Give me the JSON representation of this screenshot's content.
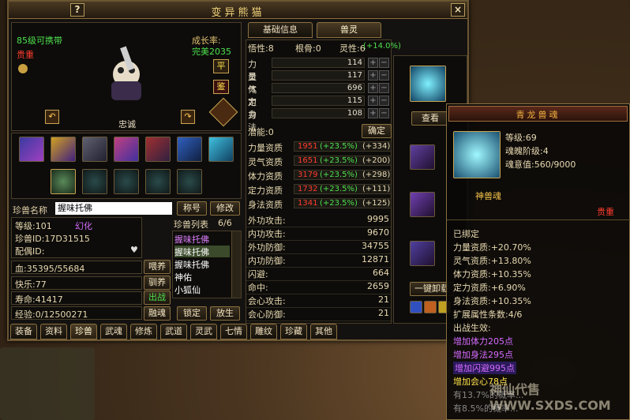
{
  "window": {
    "title": "变异熊猫",
    "help_label": "?",
    "close_label": "×"
  },
  "tabs": {
    "basic": "基础信息",
    "spirit": "兽灵"
  },
  "pet": {
    "level_text": "85级可携带",
    "rarity": "贵重",
    "growth_label": "成长率:",
    "growth_value": "完美2035",
    "personality": "忠诚",
    "btn_ping": "平",
    "btn_jian": "鉴"
  },
  "top_stats": {
    "wuxing": "悟性:8",
    "genggu": "根骨:0",
    "lingxing": "灵性:6",
    "lingxing_bonus": "(+14.0%)"
  },
  "attrs": [
    {
      "label": "力量",
      "value": "114"
    },
    {
      "label": "灵气",
      "value": "117"
    },
    {
      "label": "体力",
      "value": "696"
    },
    {
      "label": "定力",
      "value": "115"
    },
    {
      "label": "身法",
      "value": "108"
    }
  ],
  "potential": {
    "label": "潜能:0",
    "confirm": "确定"
  },
  "aptitudes": [
    {
      "label": "力量资质",
      "value": "1951",
      "bonus": "(+23.5%)",
      "extra": "(+334)"
    },
    {
      "label": "灵气资质",
      "value": "1651",
      "bonus": "(+23.5%)",
      "extra": "(+200)"
    },
    {
      "label": "体力资质",
      "value": "3179",
      "bonus": "(+23.5%)",
      "extra": "(+298)"
    },
    {
      "label": "定力资质",
      "value": "1732",
      "bonus": "(+23.5%)",
      "extra": "(+111)"
    },
    {
      "label": "身法资质",
      "value": "1341",
      "bonus": "(+23.5%)",
      "extra": "(+125)"
    }
  ],
  "combat": [
    {
      "label": "外功攻击:",
      "value": "9995"
    },
    {
      "label": "内功攻击:",
      "value": "9670"
    },
    {
      "label": "外功防御:",
      "value": "34755"
    },
    {
      "label": "内功防御:",
      "value": "12871"
    },
    {
      "label": "闪避:",
      "value": "664"
    },
    {
      "label": "命中:",
      "value": "2659"
    },
    {
      "label": "会心攻击:",
      "value": "21"
    },
    {
      "label": "会心防御:",
      "value": "21"
    }
  ],
  "spirit_panel": {
    "view_btn": "查看",
    "unload_btn": "一键卸载"
  },
  "info": {
    "name_label": "珍兽名称",
    "name_value": "握味托佛",
    "rename_btn": "称号",
    "modify_btn": "修改",
    "level": "等级:101",
    "huanhua": "幻化",
    "id": "珍兽ID:17D31515",
    "mate": "配偶ID:",
    "list_label": "珍兽列表",
    "list_count": "6/6",
    "list_items": [
      "握味托佛",
      "握味托佛",
      "握味托佛",
      "神佑",
      "小狐仙"
    ],
    "hp": "血:35395/55684",
    "feed_btn": "喂养",
    "happy": "快乐:77",
    "tame_btn": "驯养",
    "life": "寿命:41417",
    "fight_btn": "出战",
    "exp": "经验:0/12500271",
    "fuse_btn": "融魂",
    "lock_btn": "锁定",
    "release_btn": "放生"
  },
  "bottom_tabs": [
    "装备",
    "资料",
    "珍兽",
    "武魂",
    "修炼",
    "武道",
    "灵武",
    "七情",
    "雕纹",
    "珍藏",
    "其他"
  ],
  "tooltip": {
    "title": "青龙兽魂",
    "level": "等级:69",
    "soul_stage": "魂魄阶级:4",
    "soul_value": "魂意值:560/9000",
    "sub": "神兽魂",
    "rarity": "贵重",
    "bound": "已绑定",
    "lines": [
      "力量资质:+20.70%",
      "灵气资质:+13.80%",
      "体力资质:+10.35%",
      "定力资质:+6.90%",
      "身法资质:+10.35%",
      "扩展属性条数:4/6"
    ],
    "effect_title": "出战生效:",
    "effects": [
      "增加体力205点",
      "增加身法295点",
      "增加闪避995点",
      "增加会心78点"
    ],
    "tail": [
      "有13.7%的概率...",
      "有8.5%的概率..."
    ]
  },
  "watermark": "神仙代售 WWW.SXDS.COM"
}
